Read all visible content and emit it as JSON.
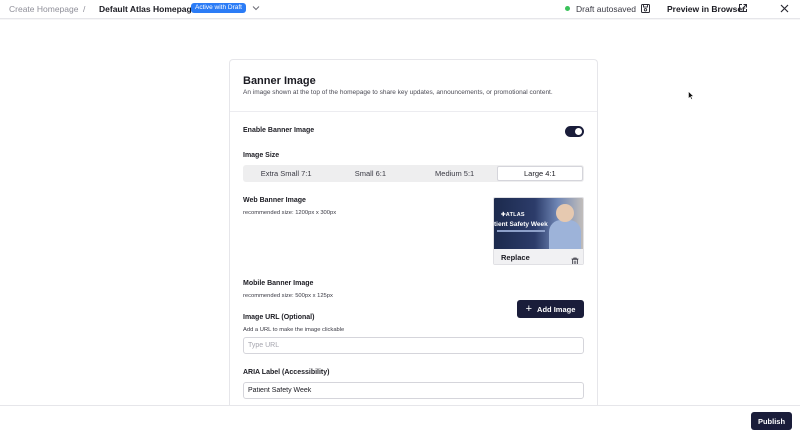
{
  "header": {
    "breadcrumb_root": "Create Homepage",
    "breadcrumb_sep": "/",
    "breadcrumb_current": "Default Atlas Homepage",
    "badge": "Active with Draft",
    "autosave": "Draft autosaved",
    "preview": "Preview in Browser",
    "status_color": "#3ac25a"
  },
  "card": {
    "title": "Banner Image",
    "description": "An image shown at the top of the homepage to share key updates, announcements, or promotional content.",
    "enable_label": "Enable Banner Image",
    "enable_on": true,
    "size_label": "Image Size",
    "sizes": [
      "Extra Small 7:1",
      "Small 6:1",
      "Medium 5:1",
      "Large 4:1"
    ],
    "size_selected": "Large 4:1",
    "web_label": "Web Banner Image",
    "web_hint": "recommended size: 1200px x 300px",
    "thumb": {
      "logo": "✚ATLAS",
      "text": "tient Safety Week",
      "replace": "Replace"
    },
    "mobile_label": "Mobile Banner Image",
    "mobile_hint": "recommended size: 500px x 125px",
    "add_image": "Add Image",
    "url_label": "Image URL (Optional)",
    "url_hint": "Add a URL to make the image clickable",
    "url_placeholder": "Type URL",
    "url_value": "",
    "aria_label": "ARIA Label (Accessibility)",
    "aria_value": "Patient Safety Week"
  },
  "footer": {
    "publish": "Publish"
  },
  "colors": {
    "accent": "#1a1d3a",
    "badge": "#2b7cf6"
  }
}
